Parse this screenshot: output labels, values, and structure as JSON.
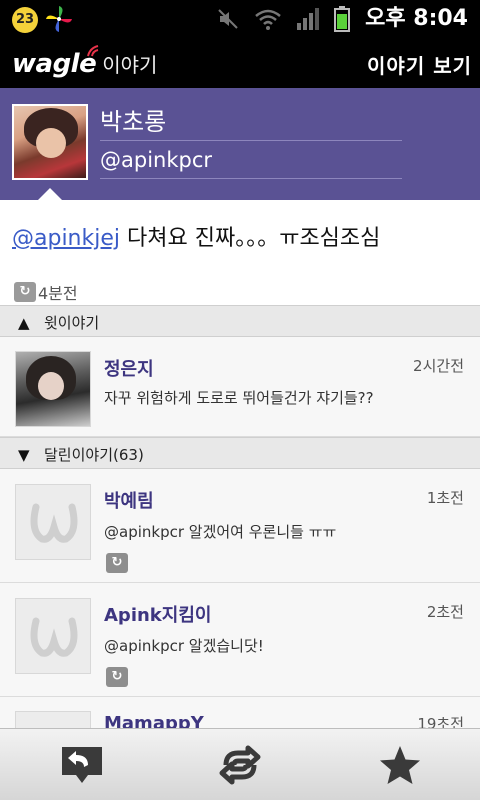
{
  "status_bar": {
    "notification_count": "23",
    "time": "오후 8:04",
    "icons": [
      "pinwheel-icon",
      "mute-icon",
      "wifi-icon",
      "signal-icon",
      "battery-icon"
    ]
  },
  "title_bar": {
    "logo_main": "wagle",
    "logo_sub": "이야기",
    "view_button": "이야기 보기"
  },
  "profile": {
    "name": "박초롱",
    "handle": "@apinkpcr"
  },
  "tweet": {
    "mention": "@apinkjej",
    "text": " 다쳐요 진짜。。。ㅠ조심조심",
    "time": "4분전"
  },
  "parent_section": {
    "label": "윗이야기",
    "item": {
      "name": "정은지",
      "time": "2시간전",
      "text": "자꾸 위험하게 도로로 뛰어들건가 쟈기들??"
    }
  },
  "replies_section": {
    "label": "달린이야기(63)",
    "items": [
      {
        "name": "박예림",
        "time": "1초전",
        "text": "@apinkpcr 알겠어여 우론니들 ㅠㅠ"
      },
      {
        "name": "Apink지킴이",
        "time": "2초전",
        "text": "@apinkpcr 알겠습니닷!"
      },
      {
        "name": "MamappY",
        "time": "19초전",
        "text": ""
      }
    ]
  },
  "bottom_bar": {
    "icons": [
      "reply-icon",
      "retweet-icon",
      "favorite-star-icon"
    ]
  },
  "colors": {
    "profile_bg": "#5a5294",
    "name_color": "#3d3580",
    "mention_color": "#3a5bc7",
    "status_bg": "#000000"
  }
}
